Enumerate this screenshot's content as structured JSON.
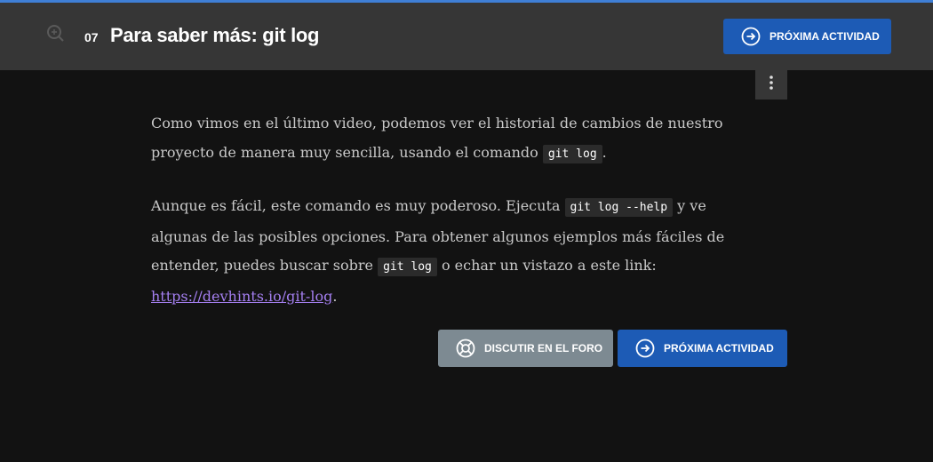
{
  "colors": {
    "accent": "#3f7fd6",
    "header_bg": "#363636",
    "page_bg": "#121212",
    "primary_button": "#1d5bb5",
    "secondary_button": "#7d8a92",
    "link": "#a47ff0",
    "code_bg": "#2b2b2b"
  },
  "header": {
    "zoom_icon": "zoom-in-icon",
    "lesson_number": "07",
    "title": "Para saber más: git log",
    "next_button": {
      "label": "PRÓXIMA ACTIVIDAD",
      "icon": "arrow-right-circle-icon"
    }
  },
  "menu": {
    "icon": "kebab-menu-icon"
  },
  "content": {
    "p1": {
      "text_before": "Como vimos en el último video, podemos ver el historial de cambios de nuestro proyecto de manera muy sencilla, usando el comando ",
      "code": "git log",
      "text_after": "."
    },
    "p2": {
      "text1": "Aunque es fácil, este comando es muy poderoso. Ejecuta ",
      "code1": "git log --help",
      "text2": " y ve algunas de las posibles opciones. Para obtener algunos ejemplos más fáciles de entender, puedes buscar sobre ",
      "code2": "git log",
      "text3": " o echar un vistazo a este link: ",
      "link": "https://devhints.io/git-log",
      "text4": "."
    }
  },
  "footer": {
    "forum_button": {
      "label": "DISCUTIR EN EL FORO",
      "icon": "lifebuoy-icon"
    },
    "next_button": {
      "label": "PRÓXIMA ACTIVIDAD",
      "icon": "arrow-right-circle-icon"
    }
  }
}
